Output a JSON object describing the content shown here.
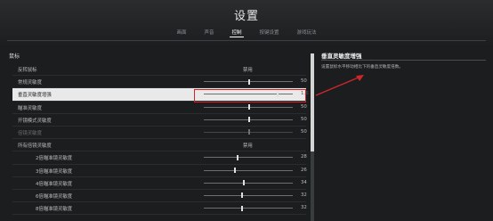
{
  "window": {
    "title": "设置"
  },
  "tabs": [
    {
      "label": "画面",
      "active": false
    },
    {
      "label": "声音",
      "active": false
    },
    {
      "label": "控制",
      "active": true
    },
    {
      "label": "按键设置",
      "active": false
    },
    {
      "label": "游戏玩法",
      "active": false
    }
  ],
  "section": {
    "title": "鼠标"
  },
  "settings": [
    {
      "label": "反转鼠标",
      "value_text": "禁用"
    },
    {
      "label": "常规灵敏度",
      "number": "50",
      "level": 0.5
    },
    {
      "label": "垂直灵敏度增强",
      "number": "1.6",
      "level": 0.82
    },
    {
      "label": "瞄准灵敏度",
      "number": "50",
      "level": 0.5
    },
    {
      "label": "开镜模式灵敏度",
      "number": "50",
      "level": 0.5
    },
    {
      "label": "倍镜灵敏度",
      "number": "50",
      "level": 0.5
    },
    {
      "label": "所有倍镜灵敏度",
      "value_text": "禁用"
    },
    {
      "label": "2倍瞄准镜灵敏度",
      "number": "28",
      "level": 0.37
    },
    {
      "label": "3倍瞄准镜灵敏度",
      "number": "26",
      "level": 0.34
    },
    {
      "label": "4倍瞄准镜灵敏度",
      "number": "34",
      "level": 0.44
    },
    {
      "label": "6倍瞄准镜灵敏度",
      "number": "32",
      "level": 0.42
    },
    {
      "label": "8倍瞄准镜灵敏度",
      "number": "32",
      "level": 0.42
    }
  ],
  "description": {
    "title": "垂直灵敏度增强",
    "text": "设置鼠标水平移动相比下的垂直灵敏度倍数。"
  },
  "colors": {
    "highlight": "#d0262a",
    "selected_row": "#e9e9e9",
    "background": "#1b1d1f"
  }
}
